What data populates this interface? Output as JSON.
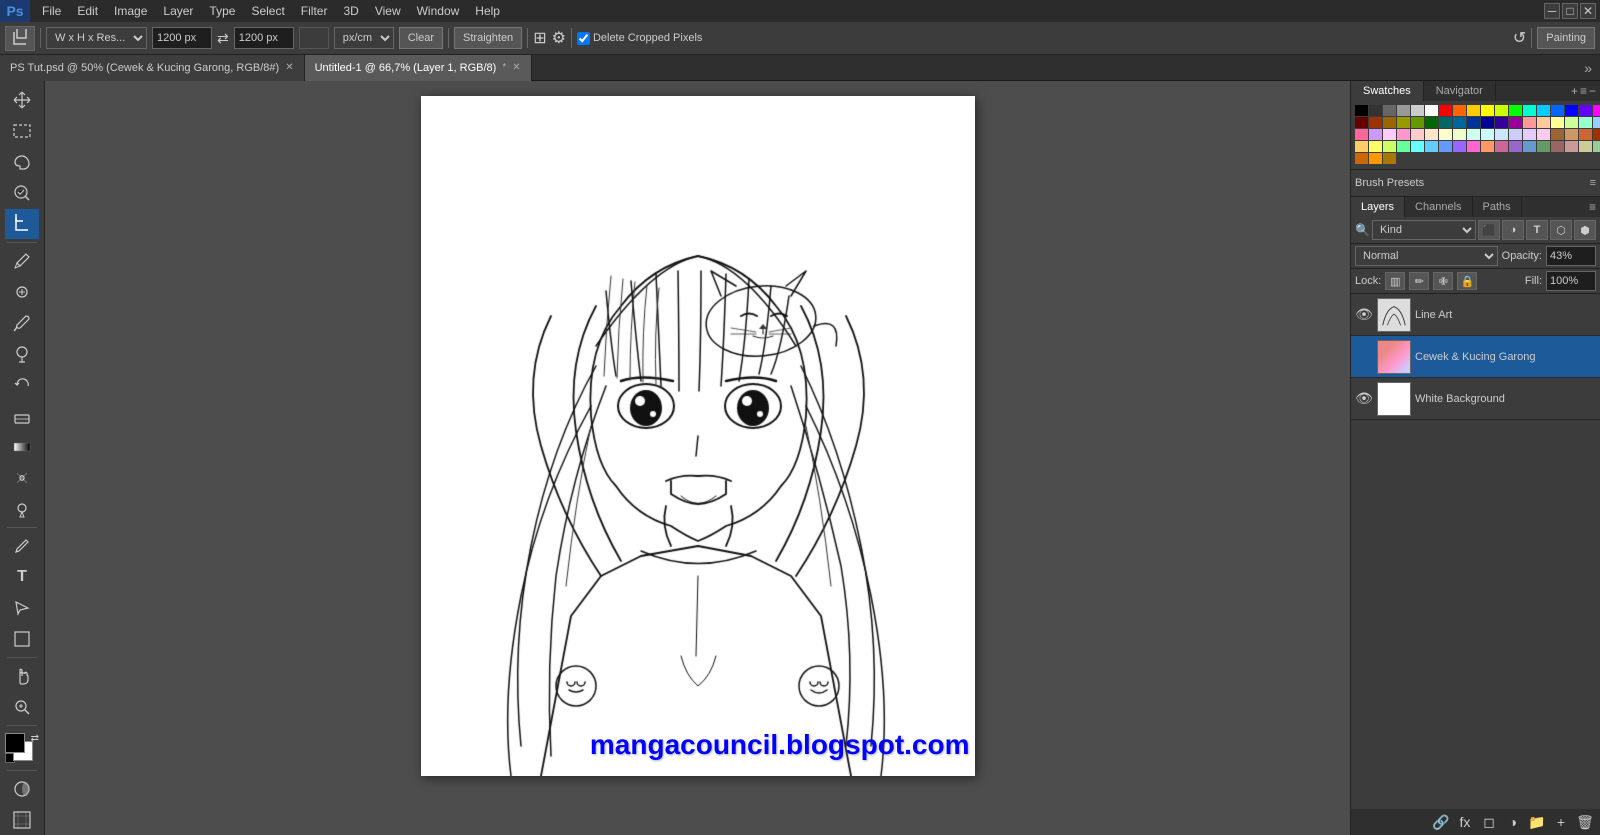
{
  "app": {
    "logo": "Ps",
    "workspace": "Painting"
  },
  "menubar": {
    "items": [
      "File",
      "Edit",
      "Image",
      "Layer",
      "Type",
      "Select",
      "Filter",
      "3D",
      "View",
      "Window",
      "Help"
    ]
  },
  "optionsbar": {
    "tool_icon": "⊹",
    "dimension_dropdown": "W x H x Res...",
    "width_value": "1200 px",
    "height_value": "1200 px",
    "unit_dropdown": "px/cm",
    "clear_btn": "Clear",
    "straighten_btn": "Straighten",
    "grid_icon": "⊞",
    "gear_icon": "⚙",
    "delete_cropped": "Delete Cropped Pixels",
    "reset_icon": "↺"
  },
  "tabs": [
    {
      "id": "tab1",
      "label": "PS Tut.psd @ 50% (Cewek & Kucing Garong, RGB/8#)",
      "active": false,
      "modified": false
    },
    {
      "id": "tab2",
      "label": "Untitled-1 @ 66,7% (Layer 1, RGB/8)",
      "active": true,
      "modified": true
    }
  ],
  "layers": {
    "blend_mode": "Normal",
    "opacity_label": "Opacity:",
    "opacity_value": "43%",
    "fill_label": "Fill:",
    "fill_value": "100%",
    "lock_label": "Lock:",
    "filter_label": "Kind",
    "items": [
      {
        "id": "layer-lineart",
        "name": "Line Art",
        "visible": true,
        "active": false,
        "thumb_type": "line"
      },
      {
        "id": "layer-cewek",
        "name": "Cewek & Kucing Garong",
        "visible": false,
        "active": true,
        "thumb_type": "color"
      },
      {
        "id": "layer-bg",
        "name": "White Background",
        "visible": true,
        "active": false,
        "thumb_type": "white"
      }
    ]
  },
  "panels": {
    "swatches_label": "Swatches",
    "navigator_label": "Navigator",
    "brush_presets_label": "Brush Presets",
    "layers_label": "Layers",
    "channels_label": "Channels",
    "paths_label": "Paths"
  },
  "swatches": {
    "row1": [
      "#000000",
      "#333333",
      "#666666",
      "#999999",
      "#cccccc",
      "#ffffff",
      "#ff0000",
      "#ff6600",
      "#ffcc00",
      "#ffff00",
      "#ccff00",
      "#00ff00",
      "#00ffcc",
      "#00ccff",
      "#0066ff",
      "#0000ff",
      "#6600ff",
      "#ff00ff"
    ],
    "row2": [
      "#660000",
      "#993300",
      "#996600",
      "#999900",
      "#669900",
      "#006600",
      "#006666",
      "#006699",
      "#003399",
      "#000099",
      "#330099",
      "#990099",
      "#ff9999",
      "#ffcc99",
      "#ffff99",
      "#ccff99",
      "#99ffcc",
      "#99ccff"
    ],
    "row3": [
      "#ff6699",
      "#cc99ff",
      "#ffccff",
      "#ff99cc",
      "#ffcccc",
      "#ffe5cc",
      "#ffffcc",
      "#eeffcc",
      "#ccffee",
      "#ccffff",
      "#cce5ff",
      "#ccccff",
      "#e5ccff",
      "#ffccee",
      "#996633",
      "#cc9966",
      "#cc6633",
      "#993300"
    ],
    "row4": [
      "#ffcc66",
      "#ffff66",
      "#ccff66",
      "#66ff99",
      "#66ffff",
      "#66ccff",
      "#6699ff",
      "#9966ff",
      "#ff66cc",
      "#ff9966",
      "#cc6699",
      "#9966cc",
      "#6699cc",
      "#669966",
      "#996666",
      "#cc9999",
      "#cccc99",
      "#99cc99"
    ],
    "extra": [
      "#cc6600",
      "#ff9900",
      "#aa7700"
    ]
  },
  "watermark": "mangacouncil.blogspot.com"
}
